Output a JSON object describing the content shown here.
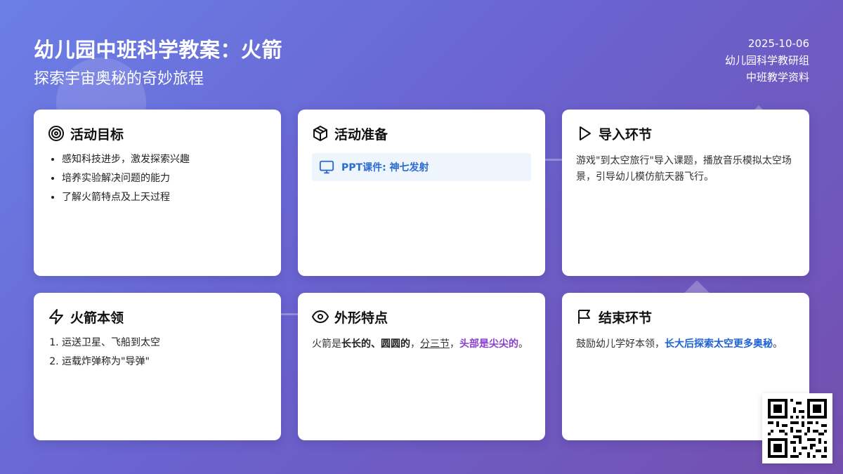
{
  "header": {
    "title": "幼儿园中班科学教案：火箭",
    "subtitle": "探索宇宙奥秘的奇妙旅程",
    "date": "2025-10-06",
    "group": "幼儿园科学教研组",
    "category": "中班教学资料"
  },
  "cards": {
    "goals": {
      "title": "活动目标",
      "icon": "target-icon",
      "items": [
        "感知科技进步，激发探索兴趣",
        "培养实验解决问题的能力",
        "了解火箭特点及上天过程"
      ]
    },
    "prep": {
      "title": "活动准备",
      "icon": "box-icon",
      "item_icon": "monitor-icon",
      "item_label": "PPT课件: 神七发射"
    },
    "intro": {
      "title": "导入环节",
      "icon": "play-icon",
      "text": "游戏\"到太空旅行\"导入课题，播放音乐模拟太空场景，引导幼儿模仿航天器飞行。"
    },
    "abilities": {
      "title": "火箭本领",
      "icon": "lightning-icon",
      "items": [
        "运送卫星、飞船到太空",
        "运载炸弹称为\"导弹\""
      ]
    },
    "shape": {
      "title": "外形特点",
      "icon": "eye-icon",
      "prefix": "火箭是",
      "bold1": "长长的、圆圆的",
      "sep1": "，",
      "underlined": "分三节",
      "sep2": "，",
      "highlight": "头部是尖尖的",
      "end": "。"
    },
    "ending": {
      "title": "结束环节",
      "icon": "flag-icon",
      "prefix": "鼓励幼儿学好本领，",
      "highlight": "长大后探索太空更多奥秘",
      "end": "。"
    }
  },
  "colors": {
    "accent_blue": "#1f63d6",
    "accent_purple": "#8a3fd1",
    "prep_bg": "#eef5fd"
  },
  "qr": {
    "icon": "qr-code-icon"
  }
}
